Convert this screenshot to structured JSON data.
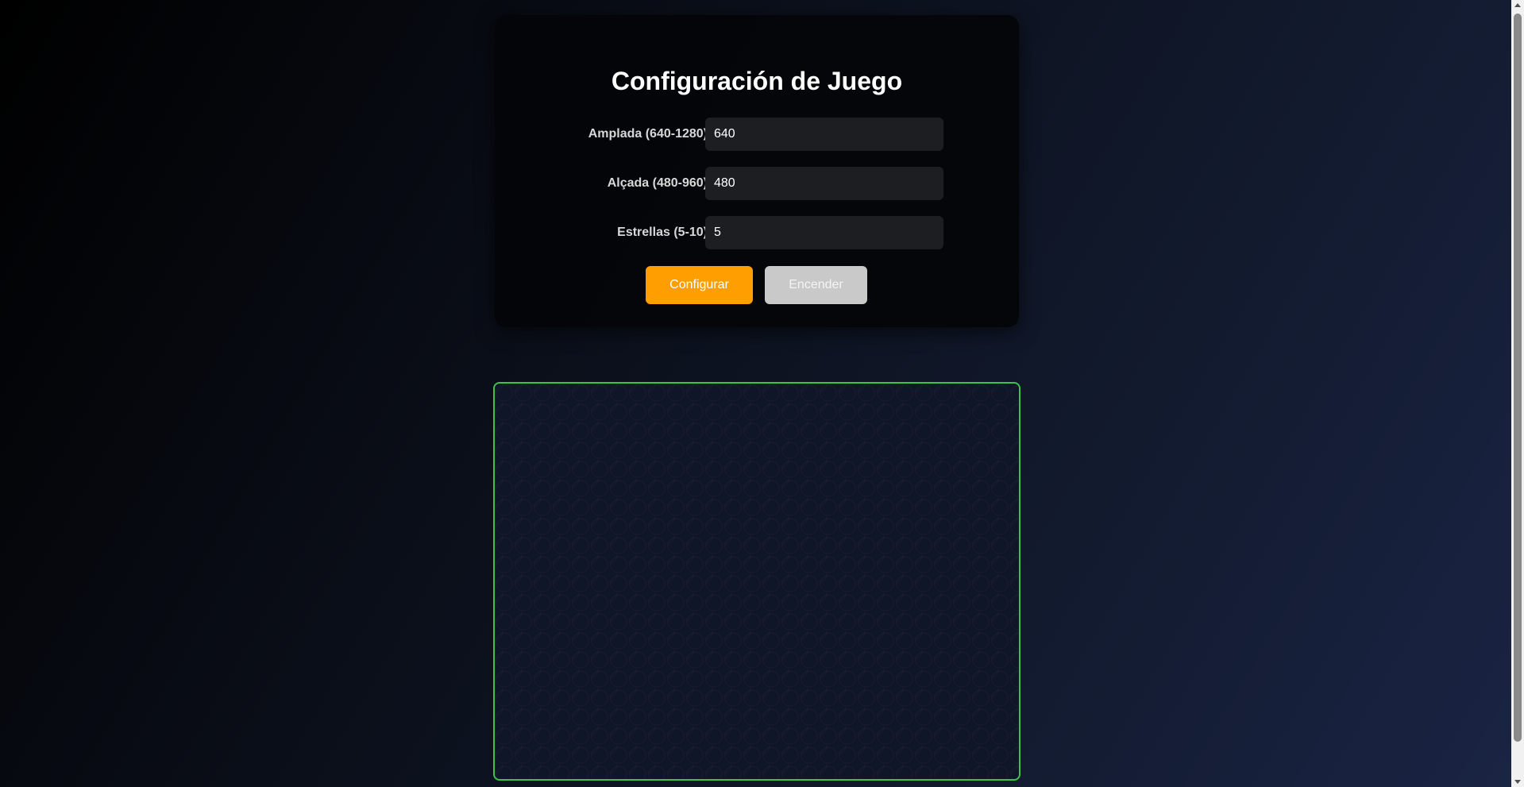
{
  "config_panel": {
    "title": "Configuración de Juego",
    "fields": [
      {
        "label": "Amplada (640-1280)",
        "value": "640"
      },
      {
        "label": "Alçada (480-960)",
        "value": "480"
      },
      {
        "label": "Estrellas (5-10)",
        "value": "5"
      }
    ],
    "configure_label": "Configurar",
    "start_label": "Encender"
  },
  "colors": {
    "accent": "#ff9e00",
    "canvas_border": "#3fc24a",
    "disabled_button": "#c9c9c9"
  },
  "icons": {
    "scroll_up": "chevron-up-icon",
    "scroll_down": "chevron-down-icon"
  }
}
